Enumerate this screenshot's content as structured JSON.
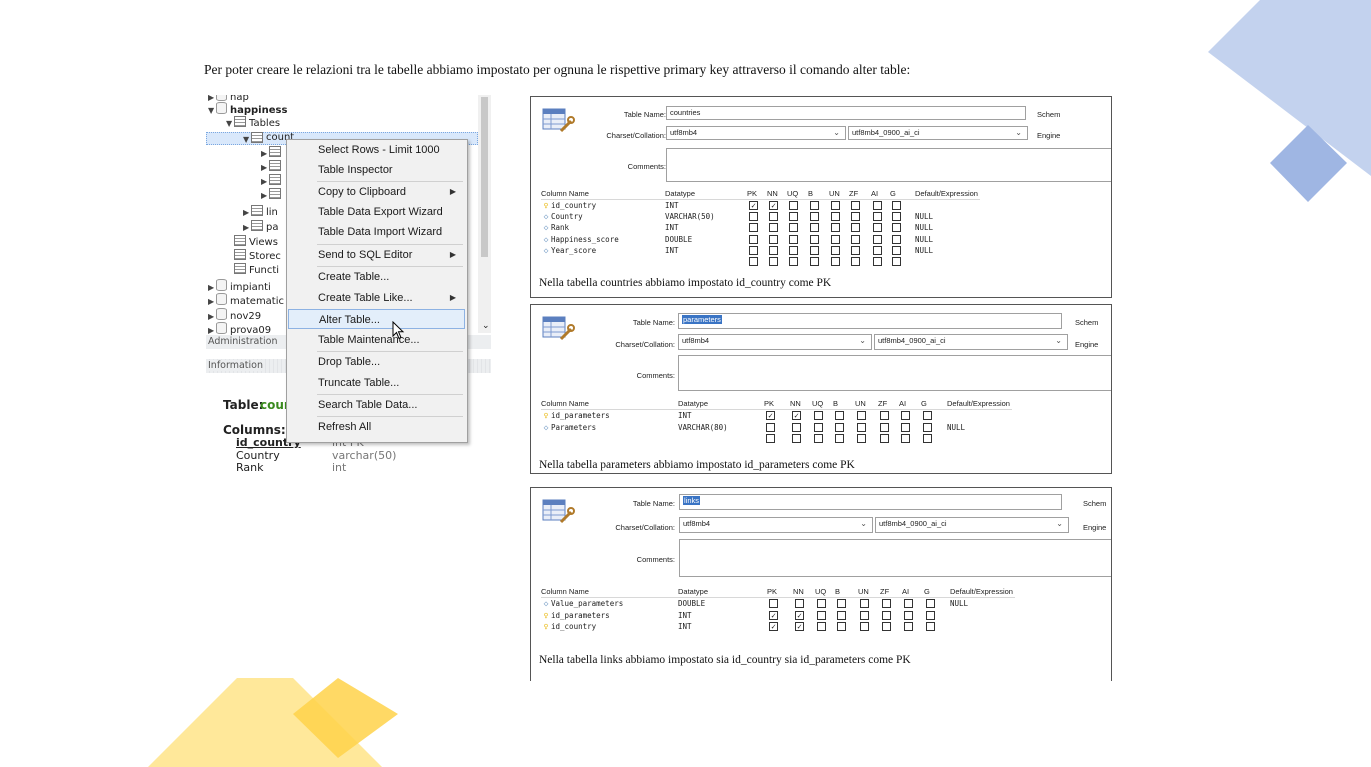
{
  "intro_text": "Per poter creare le relazioni tra le tabelle abbiamo impostato per ognuna le rispettive primary key attraverso il comando alter table:",
  "colors": {
    "deco_blue": "#c3d2ee",
    "deco_blue_dark": "#9fb6e3",
    "deco_yellow": "#ffe89a",
    "deco_yellow_dark": "#ffd24a",
    "selection": "#d9e8fb"
  },
  "navigator": {
    "tree": [
      {
        "label": "nap",
        "icon": "database-icon",
        "level": 0,
        "expanded": false
      },
      {
        "label": "happiness",
        "icon": "database-icon",
        "level": 0,
        "expanded": true
      },
      {
        "label": "Tables",
        "icon": "tables-folder-icon",
        "level": 1,
        "expanded": true
      },
      {
        "label": "countries",
        "icon": "table-icon",
        "level": 2,
        "expanded": true
      },
      {
        "label": "",
        "icon": "columns-icon",
        "level": 3
      },
      {
        "label": "",
        "icon": "indexes-icon",
        "level": 3
      },
      {
        "label": "",
        "icon": "foreign-keys-icon",
        "level": 3
      },
      {
        "label": "",
        "icon": "triggers-icon",
        "level": 3
      },
      {
        "label": "lin",
        "icon": "table-icon",
        "level": 2
      },
      {
        "label": "pa",
        "icon": "table-icon",
        "level": 2
      },
      {
        "label": "Views",
        "icon": "views-icon",
        "level": 1
      },
      {
        "label": "Storec",
        "icon": "procedures-icon",
        "level": 1
      },
      {
        "label": "Functi",
        "icon": "functions-icon",
        "level": 1
      },
      {
        "label": "impianti",
        "icon": "database-icon",
        "level": 0
      },
      {
        "label": "matematic",
        "icon": "database-icon",
        "level": 0
      },
      {
        "label": "nov29",
        "icon": "database-icon",
        "level": 0
      },
      {
        "label": "prova09",
        "icon": "database-icon",
        "level": 0
      }
    ],
    "administration_tab": "Administration",
    "information_header": "Information",
    "info_table_label": "Table:",
    "info_table_value": "cour",
    "columns_label": "Columns:",
    "columns": [
      {
        "name": "id_country",
        "type": "int PK"
      },
      {
        "name": "Country",
        "type": "varchar(50)"
      },
      {
        "name": "Rank",
        "type": "int"
      }
    ]
  },
  "context_menu": {
    "items": [
      {
        "label": "Select Rows - Limit 1000",
        "submenu": false
      },
      {
        "label": "Table Inspector",
        "submenu": false
      },
      {
        "label": "Copy to Clipboard",
        "submenu": true
      },
      {
        "label": "Table Data Export Wizard",
        "submenu": false
      },
      {
        "label": "Table Data Import Wizard",
        "submenu": false
      },
      {
        "label": "Send to SQL Editor",
        "submenu": true
      },
      {
        "label": "Create Table...",
        "submenu": false
      },
      {
        "label": "Create Table Like...",
        "submenu": true
      },
      {
        "label": "Alter Table...",
        "submenu": false,
        "highlighted": true
      },
      {
        "label": "Table Maintenance...",
        "submenu": false
      },
      {
        "label": "Drop Table...",
        "submenu": false
      },
      {
        "label": "Truncate Table...",
        "submenu": false
      },
      {
        "label": "Search Table Data...",
        "submenu": false
      },
      {
        "label": "Refresh All",
        "submenu": false
      }
    ]
  },
  "editors": [
    {
      "labels": {
        "table_name": "Table Name:",
        "charset": "Charset/Collation:",
        "comments": "Comments:",
        "schema": "Schem",
        "engine": "Engine"
      },
      "table_name": "countries",
      "name_selected": false,
      "charset": "utf8mb4",
      "collation": "utf8mb4_0900_ai_ci",
      "headers": [
        "Column Name",
        "Datatype",
        "PK",
        "NN",
        "UQ",
        "B",
        "UN",
        "ZF",
        "AI",
        "G",
        "Default/Expression"
      ],
      "rows": [
        {
          "name": "id_country",
          "type": "INT",
          "key": "pk",
          "flags": [
            1,
            1,
            0,
            0,
            0,
            0,
            0,
            0
          ],
          "default": ""
        },
        {
          "name": "Country",
          "type": "VARCHAR(50)",
          "key": "col",
          "flags": [
            0,
            0,
            0,
            0,
            0,
            0,
            0,
            0
          ],
          "default": "NULL"
        },
        {
          "name": "Rank",
          "type": "INT",
          "key": "col",
          "flags": [
            0,
            0,
            0,
            0,
            0,
            0,
            0,
            0
          ],
          "default": "NULL"
        },
        {
          "name": "Happiness_score",
          "type": "DOUBLE",
          "key": "col",
          "flags": [
            0,
            0,
            0,
            0,
            0,
            0,
            0,
            0
          ],
          "default": "NULL"
        },
        {
          "name": "Year_score",
          "type": "INT",
          "key": "col",
          "flags": [
            0,
            0,
            0,
            0,
            0,
            0,
            0,
            0
          ],
          "default": "NULL"
        },
        {
          "name": "",
          "type": "",
          "key": "",
          "flags": [
            0,
            0,
            0,
            0,
            0,
            0,
            0,
            0
          ],
          "default": ""
        }
      ],
      "caption": "Nella tabella countries abbiamo impostato id_country come PK"
    },
    {
      "labels": {
        "table_name": "Table Name:",
        "charset": "Charset/Collation:",
        "comments": "Comments:",
        "schema": "Schem",
        "engine": "Engine"
      },
      "table_name": "parameters",
      "name_selected": true,
      "charset": "utf8mb4",
      "collation": "utf8mb4_0900_ai_ci",
      "headers": [
        "Column Name",
        "Datatype",
        "PK",
        "NN",
        "UQ",
        "B",
        "UN",
        "ZF",
        "AI",
        "G",
        "Default/Expression"
      ],
      "rows": [
        {
          "name": "id_parameters",
          "type": "INT",
          "key": "pk",
          "flags": [
            1,
            1,
            0,
            0,
            0,
            0,
            0,
            0
          ],
          "default": ""
        },
        {
          "name": "Parameters",
          "type": "VARCHAR(80)",
          "key": "col",
          "flags": [
            0,
            0,
            0,
            0,
            0,
            0,
            0,
            0
          ],
          "default": "NULL"
        },
        {
          "name": "",
          "type": "",
          "key": "",
          "flags": [
            0,
            0,
            0,
            0,
            0,
            0,
            0,
            0
          ],
          "default": ""
        }
      ],
      "caption": "Nella tabella parameters abbiamo impostato id_parameters come PK"
    },
    {
      "labels": {
        "table_name": "Table Name:",
        "charset": "Charset/Collation:",
        "comments": "Comments:",
        "schema": "Schem",
        "engine": "Engine"
      },
      "table_name": "links",
      "name_selected": true,
      "charset": "utf8mb4",
      "collation": "utf8mb4_0900_ai_ci",
      "headers": [
        "Column Name",
        "Datatype",
        "PK",
        "NN",
        "UQ",
        "B",
        "UN",
        "ZF",
        "AI",
        "G",
        "Default/Expression"
      ],
      "rows": [
        {
          "name": "Value_parameters",
          "type": "DOUBLE",
          "key": "col",
          "flags": [
            0,
            0,
            0,
            0,
            0,
            0,
            0,
            0
          ],
          "default": "NULL"
        },
        {
          "name": "id_parameters",
          "type": "INT",
          "key": "pk",
          "flags": [
            1,
            1,
            0,
            0,
            0,
            0,
            0,
            0
          ],
          "default": ""
        },
        {
          "name": "id_country",
          "type": "INT",
          "key": "pk",
          "flags": [
            1,
            1,
            0,
            0,
            0,
            0,
            0,
            0
          ],
          "default": ""
        }
      ],
      "caption": "Nella tabella links abbiamo impostato sia id_country sia id_parameters come PK"
    }
  ]
}
